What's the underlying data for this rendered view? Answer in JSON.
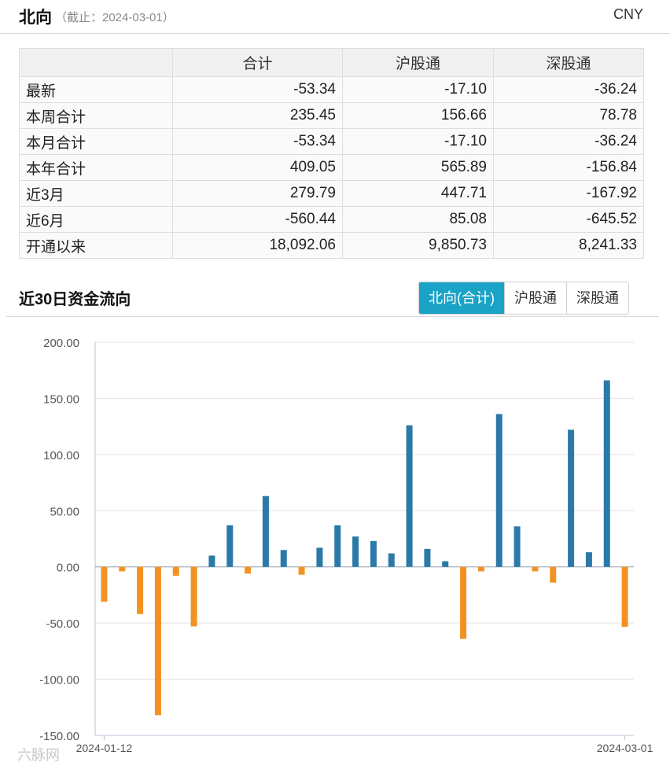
{
  "header": {
    "title": "北向",
    "subtitle": "（截止：2024-03-01）",
    "currency": "CNY"
  },
  "table": {
    "columns": [
      "",
      "合计",
      "沪股通",
      "深股通"
    ],
    "rows": [
      {
        "label": "最新",
        "total": "-53.34",
        "sh": "-17.10",
        "sz": "-36.24"
      },
      {
        "label": "本周合计",
        "total": "235.45",
        "sh": "156.66",
        "sz": "78.78"
      },
      {
        "label": "本月合计",
        "total": "-53.34",
        "sh": "-17.10",
        "sz": "-36.24"
      },
      {
        "label": "本年合计",
        "total": "409.05",
        "sh": "565.89",
        "sz": "-156.84"
      },
      {
        "label": "近3月",
        "total": "279.79",
        "sh": "447.71",
        "sz": "-167.92"
      },
      {
        "label": "近6月",
        "total": "-560.44",
        "sh": "85.08",
        "sz": "-645.52"
      },
      {
        "label": "开通以来",
        "total": "18,092.06",
        "sh": "9,850.73",
        "sz": "8,241.33"
      }
    ]
  },
  "section": {
    "title": "近30日资金流向",
    "tabs": [
      "北向(合计)",
      "沪股通",
      "深股通"
    ],
    "active_tab": "北向(合计)"
  },
  "colors": {
    "positive": "#2b79a8",
    "negative": "#f39222",
    "active_tab": "#1aa3c6",
    "grid": "#e3e3e3"
  },
  "watermark": "六脉网",
  "chart_data": {
    "type": "bar",
    "ylim": [
      -150,
      200
    ],
    "yticks": [
      "200.00",
      "150.00",
      "100.00",
      "50.00",
      "0.00",
      "-50.00",
      "-100.00",
      "-150.00"
    ],
    "x_labels": [
      "2024-01-12",
      "2024-03-01"
    ],
    "values": [
      -31,
      -4,
      -42,
      -132,
      -8,
      -53,
      10,
      37,
      -6,
      63,
      15,
      -7,
      17,
      37,
      27,
      23,
      12,
      126,
      16,
      5,
      -64,
      -4,
      136,
      36,
      -4,
      -14,
      122,
      13,
      166,
      -53.34
    ]
  }
}
